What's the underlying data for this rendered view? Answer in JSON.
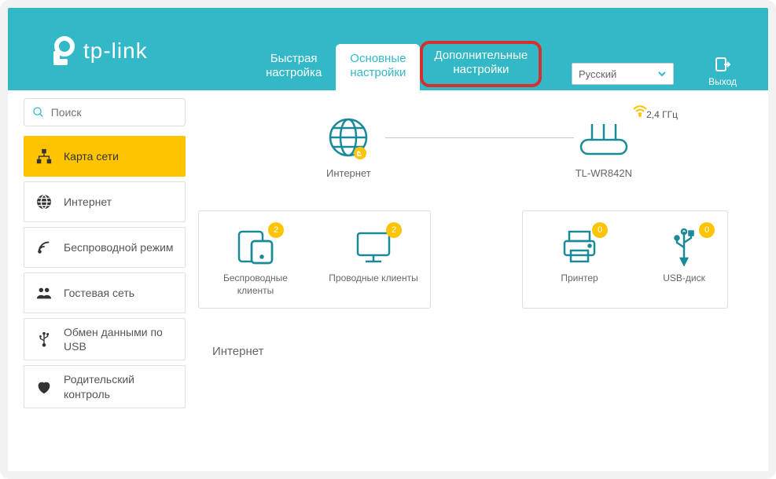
{
  "brand": "tp-link",
  "header": {
    "tabs": {
      "quick": "Быстрая\nнастройка",
      "basic": "Основные\nнастройки",
      "advanced": "Дополнительные\nнастройки"
    },
    "language": "Русский",
    "logout": "Выход"
  },
  "search": {
    "placeholder": "Поиск"
  },
  "sidebar": {
    "map": "Карта сети",
    "internet": "Интернет",
    "wireless": "Беспроводной режим",
    "guest": "Гостевая сеть",
    "usb": "Обмен данными по USB",
    "parental": "Родительский контроль"
  },
  "topology": {
    "internet": "Интернет",
    "router_model": "TL-WR842N",
    "freq": "2,4 ГГц"
  },
  "clients": {
    "wireless": {
      "label": "Беспроводные клиенты",
      "count": "2"
    },
    "wired": {
      "label": "Проводные клиенты",
      "count": "2"
    },
    "printer": {
      "label": "Принтер",
      "count": "0"
    },
    "usb": {
      "label": "USB-диск",
      "count": "0"
    }
  },
  "section": {
    "internet": "Интернет"
  }
}
